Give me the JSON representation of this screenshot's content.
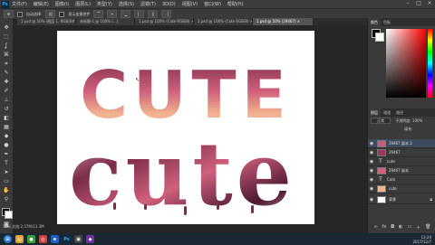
{
  "menu": {
    "logo": "Ps",
    "items": [
      "文件(F)",
      "编辑(E)",
      "图像(I)",
      "图层(L)",
      "类型(Y)",
      "选择(S)",
      "滤镜(T)",
      "3D(D)",
      "视图(V)",
      "窗口(W)",
      "帮助(H)"
    ]
  },
  "options": {
    "auto_select": "自动选择:",
    "group": "组",
    "transform": "显示变换控件"
  },
  "tabs": [
    {
      "label": "1.psd @ 50% (图层 1, RGB/8#) ×"
    },
    {
      "label": "未标题-1 @ 100% (...)"
    },
    {
      "label": "1.psd @ 100% (Cute RGB/8) ×"
    },
    {
      "label": "2.psd @ 100% (Cute RGB/8) ×"
    },
    {
      "label": "1.psd @ 50% (29467) ×"
    }
  ],
  "canvas": {
    "word_top": "CUTE",
    "word_bottom": "cute",
    "colors": {
      "pink_light": "#f0b0c8",
      "pink": "#d0607c",
      "plum": "#7a2c48",
      "deep": "#4a1830",
      "peach": "#f2b38f"
    }
  },
  "color_panel": {
    "tabs": [
      "颜色",
      "色板"
    ]
  },
  "layers_panel": {
    "tabs": [
      "图层",
      "通道",
      "路径"
    ],
    "blend_mode": "正常",
    "opacity_label": "不透明度:",
    "opacity_value": "100%",
    "fill_label": "填充:",
    "layers": [
      {
        "name": "29467 副本 2"
      },
      {
        "name": "29467"
      },
      {
        "name": "cute"
      },
      {
        "name": "29467 副本"
      },
      {
        "name": "Cute"
      },
      {
        "name": "cute"
      },
      {
        "name": "背景"
      }
    ]
  },
  "status": {
    "zoom": "50%",
    "doc": "文档:2.57M/13.3M"
  },
  "taskbar": {
    "clock_time": "13:24",
    "clock_date": "2017/12/7"
  }
}
